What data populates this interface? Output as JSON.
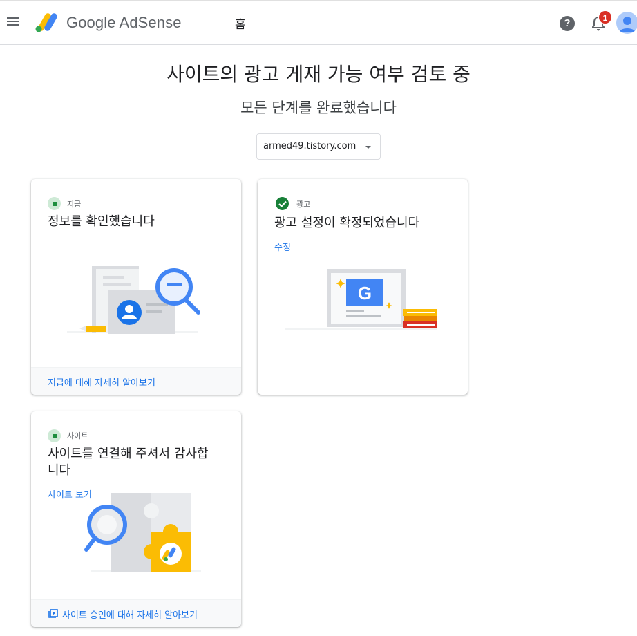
{
  "topbar": {
    "product_name": "Google AdSense",
    "page": "홈",
    "help_label": "?",
    "notification_count": "1"
  },
  "header": {
    "title": "사이트의 광고 게재 가능 여부 검토 중",
    "subtitle": "모든 단계를 완료했습니다",
    "site_select": {
      "value": "armed49.tistory.com"
    }
  },
  "cards": {
    "payment": {
      "tag": "지급",
      "status": "pending",
      "title": "정보를 확인했습니다",
      "footer_link": "지급에 대해 자세히 알아보기"
    },
    "ads": {
      "tag": "광고",
      "status": "done",
      "title": "광고 설정이 확정되었습니다",
      "link": "수정"
    },
    "site": {
      "tag": "사이트",
      "status": "pending",
      "title_line1": "사이트를 연결해 주셔서 감사합",
      "title_line2": "니다",
      "link": "사이트 보기",
      "footer_link": "사이트 승인에 대해 자세히 알아보기"
    }
  },
  "colors": {
    "link": "#1a73e8",
    "status_done": "#188038",
    "status_pending_bg": "#ceead6",
    "badge": "#d93025",
    "logo_yellow": "#fbbc04",
    "logo_blue": "#4285f4",
    "logo_green": "#34a853"
  },
  "icons": {
    "menu": "hamburger-icon",
    "help": "help-circle-icon",
    "notifications": "bell-icon",
    "account": "avatar-icon",
    "dropdown": "caret-down-icon",
    "check": "check-circle-icon",
    "video": "video-library-icon"
  }
}
